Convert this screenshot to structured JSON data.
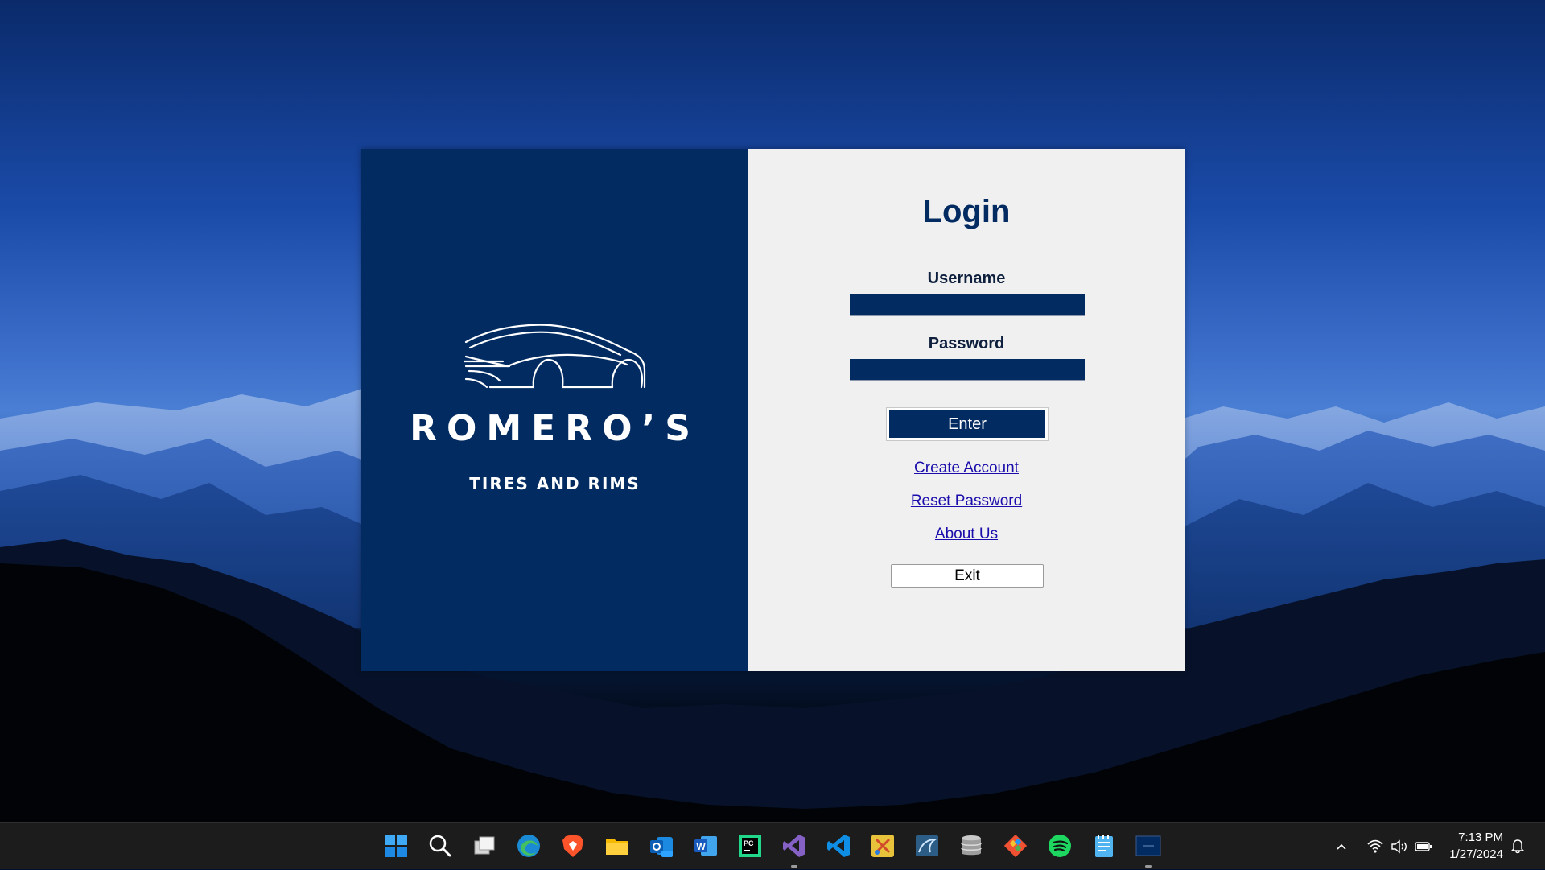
{
  "brand": {
    "name": "ROMERO’S",
    "tagline": "TIRES AND RIMS"
  },
  "login": {
    "title": "Login",
    "username_label": "Username",
    "username_value": "",
    "password_label": "Password",
    "password_value": "",
    "enter_label": "Enter",
    "create_account_label": "Create Account",
    "reset_password_label": "Reset Password",
    "about_us_label": "About Us",
    "exit_label": "Exit"
  },
  "colors": {
    "brand_navy": "#022b61",
    "form_background": "#f0f0f0",
    "link_blue": "#1a0dab"
  },
  "taskbar": {
    "apps": [
      {
        "name": "start-icon",
        "running": false
      },
      {
        "name": "search-icon",
        "running": false
      },
      {
        "name": "task-view-icon",
        "running": false
      },
      {
        "name": "edge-icon",
        "running": false
      },
      {
        "name": "brave-icon",
        "running": false
      },
      {
        "name": "file-explorer-icon",
        "running": false
      },
      {
        "name": "outlook-new-icon",
        "running": false
      },
      {
        "name": "word-icon",
        "running": false
      },
      {
        "name": "pycharm-icon",
        "running": false
      },
      {
        "name": "visual-studio-icon",
        "running": true
      },
      {
        "name": "vscode-icon",
        "running": false
      },
      {
        "name": "snipping-tool-icon",
        "running": false
      },
      {
        "name": "mysql-workbench-icon",
        "running": false
      },
      {
        "name": "database-icon",
        "running": false
      },
      {
        "name": "git-icon",
        "running": false
      },
      {
        "name": "spotify-icon",
        "running": false
      },
      {
        "name": "notepad-icon",
        "running": false
      },
      {
        "name": "login-app-icon",
        "running": true
      }
    ],
    "time": "7:13 PM",
    "date": "1/27/2024"
  }
}
